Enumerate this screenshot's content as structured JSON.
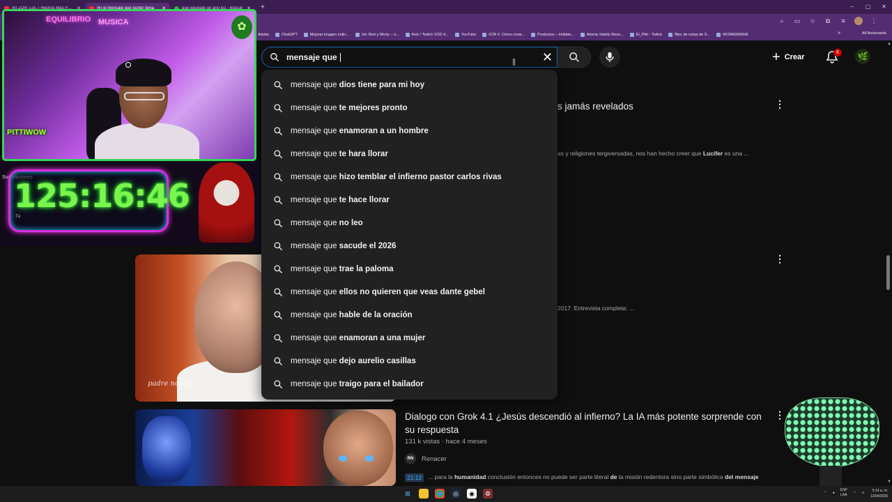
{
  "browser": {
    "tabs": [
      {
        "label": "(6) ZOR: Los 7 Hechos Más Perturbadores",
        "icon": "youtube-icon",
        "active": false
      },
      {
        "label": "(6) el mensaje que lucifer tenia",
        "icon": "youtube-icon",
        "active": true
      },
      {
        "label": "que equivale un año luz - Buscar",
        "icon": "google-icon",
        "active": false
      }
    ],
    "new_tab": "+",
    "bookmarks": [
      "Adobe",
      "ChatGPT",
      "Mejorar imagen onlin...",
      "Ver Rick y Morty – o...",
      "Kick / Twitch VOD d...",
      "YouTube",
      "GTA V: Cómo crear...",
      "Productos – Hobbie...",
      "Atomic Habits Reso...",
      "El_Pitti - Twitch",
      "Bloc de notas de S...",
      "WOMIER68HE"
    ],
    "bookmarks_more": "»",
    "all_bookmarks": "All Bookmarks"
  },
  "youtube": {
    "search_value": "mensaje que ",
    "create_label": "Crear",
    "notification_count": "6",
    "suggestion_prefix": "mensaje que",
    "suggestions": [
      "dios tiene para mi hoy",
      "te mejores pronto",
      "enamoran a un hombre",
      "te hara llorar",
      "hizo temblar el infierno pastor carlos rivas",
      "te hace llorar",
      "no leo",
      "sacude el 2026",
      "trae la paloma",
      "ellos no quieren que veas dante gebel",
      "hable de la oración",
      "enamoran a una mujer",
      "dejo aurelio casillas",
      "traigo para el bailador"
    ],
    "results": {
      "r1_title_fragment": "s jamás revelados",
      "r1_desc_prefix": "as y religiones tergiversadas, nos han hecho creer que ",
      "r1_desc_bold": "Lucifer",
      "r1_desc_suffix": " es una ...",
      "r2_desc": "2017. Entrevista completa: ...",
      "r2_thumb_sign": "padre nostro",
      "r3_title": "Dialogo con Grok 4.1 ¿Jesús descendió al infierno? La IA más potente sorprende con su respuesta",
      "r3_meta": "131 k vistas · hace 4 meses",
      "r3_channel_avatar": "RN",
      "r3_channel": "Renacer",
      "r3_timestamp": "21:12",
      "r3_chapter_pre": "... para la ",
      "r3_chapter_bold1": "humanidad",
      "r3_chapter_mid1": " conclusión entonces no puede ser parte literal ",
      "r3_chapter_bold2": "de",
      "r3_chapter_mid2": " la misión redentora sino parte simbólica ",
      "r3_chapter_bold3": "del mensaje"
    }
  },
  "overlay": {
    "timer": "125:16:46",
    "subs_label": "Suscripciones",
    "tu_label": "Tú",
    "cam_logo": "PITTIWOW",
    "neon_left": "EQUILIBRIO",
    "neon_right": "MUSICA"
  },
  "taskbar": {
    "lang_top": "ESP",
    "lang_bottom": "LAA",
    "time": "5:14 a. m.",
    "date": "12/04/2026"
  }
}
